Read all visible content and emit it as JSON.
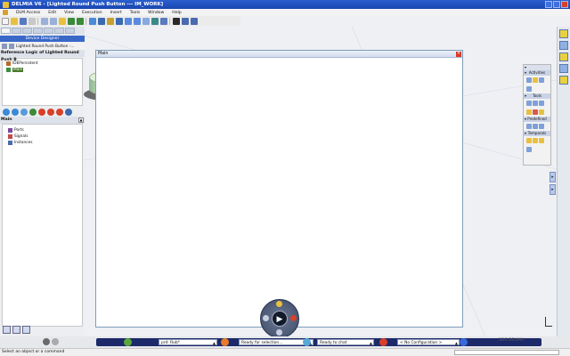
{
  "window": {
    "title": "DELMIA V6 - [Lighted Round Push Button --- IM_WORK]"
  },
  "menubar": {
    "items": [
      "DLM Access",
      "Edit",
      "View",
      "Execution",
      "Insert",
      "Tools",
      "Window",
      "Help"
    ]
  },
  "left_panel": {
    "banner": "Device Designer",
    "breadcrumb": "Lighted Round Push Button -...",
    "logic_title": "Reference Logic of Lighted Round Push B",
    "tree": [
      {
        "label": "IDEPersistent",
        "selected": false
      },
      {
        "label": "Main",
        "selected": true
      }
    ],
    "main_section": "Main",
    "main_tree": [
      "Ports",
      "Signals",
      "Instances"
    ]
  },
  "main_window": {
    "title": "Main"
  },
  "palette": {
    "sections": [
      "Activities",
      "Tools",
      "Predefined",
      "Temporals"
    ]
  },
  "command": {
    "prd_value": "prd: Rub*",
    "selection_status": "Ready for selection...",
    "chat_status": "Ready to chat",
    "configuration": "< No Configuration >"
  },
  "statusline": {
    "message": "Select an object or a command"
  },
  "watermark": "3DS DELMIA"
}
